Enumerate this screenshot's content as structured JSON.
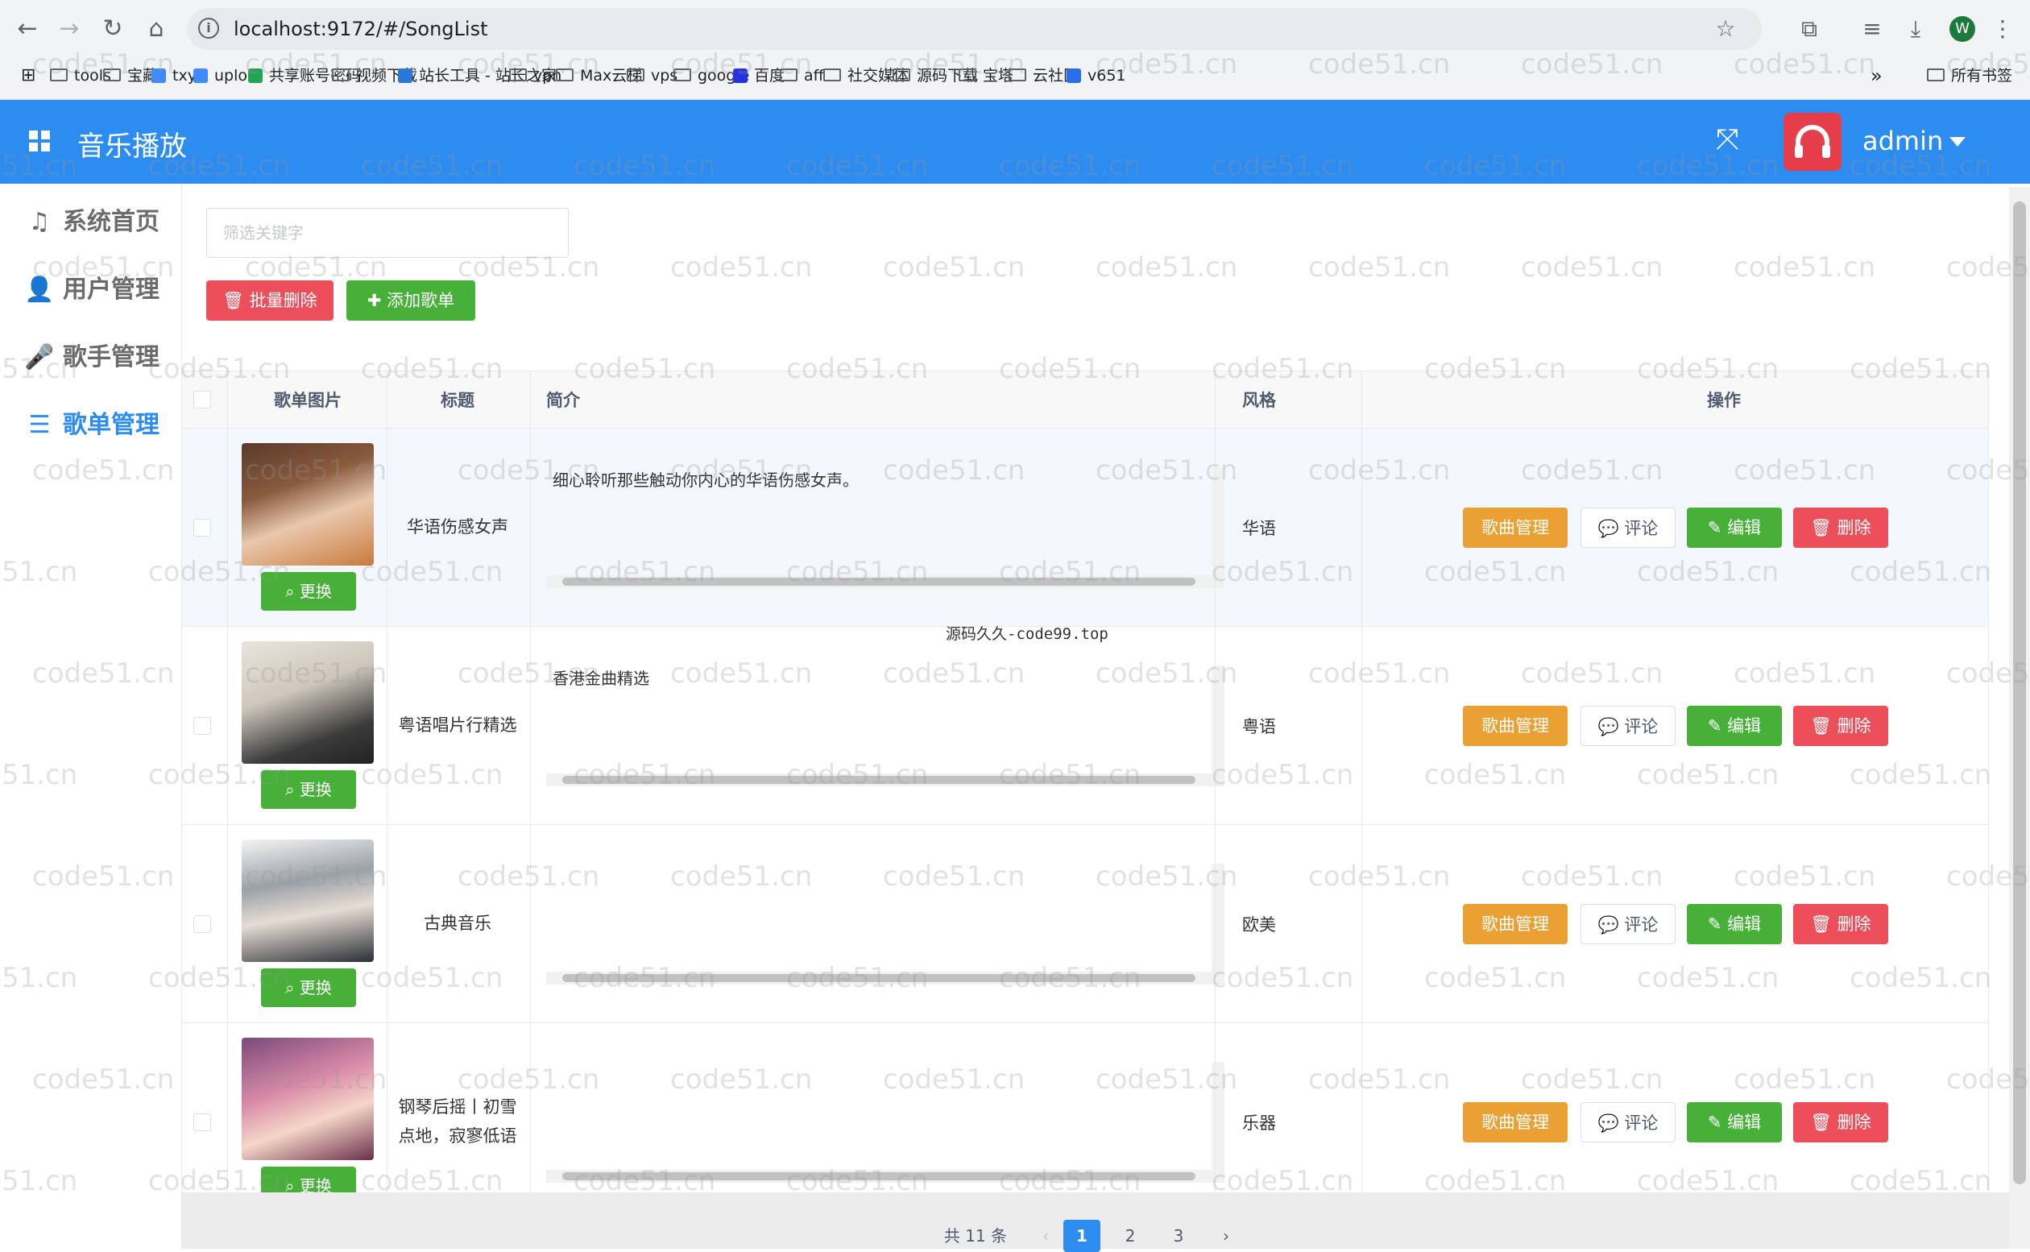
{
  "browser": {
    "url": "localhost:9172/#/SongList",
    "profile_initial": "W",
    "bookmarks": [
      {
        "label": "tools",
        "kind": "folder"
      },
      {
        "label": "宝藏",
        "kind": "folder"
      },
      {
        "label": "txy",
        "kind": "site",
        "color": "#3d8bfd"
      },
      {
        "label": "uplod",
        "kind": "site",
        "color": "#3d8bfd"
      },
      {
        "label": "共享账号密码",
        "kind": "site",
        "color": "#23a455"
      },
      {
        "label": "视频下载",
        "kind": "folder"
      },
      {
        "label": "站长工具 - 站长之家",
        "kind": "site",
        "color": "#2b77d8"
      },
      {
        "label": "vpn",
        "kind": "folder"
      },
      {
        "label": "Max云梯",
        "kind": "folder"
      },
      {
        "label": "vps",
        "kind": "folder"
      },
      {
        "label": "google",
        "kind": "folder"
      },
      {
        "label": "百度",
        "kind": "site",
        "color": "#2932e1"
      },
      {
        "label": "aff",
        "kind": "folder"
      },
      {
        "label": "社交媒体",
        "kind": "folder"
      },
      {
        "label": "源码下载",
        "kind": "folder"
      },
      {
        "label": "宝塔",
        "kind": "folder"
      },
      {
        "label": "云社区",
        "kind": "folder"
      },
      {
        "label": "v651",
        "kind": "site",
        "color": "#2a6fe8"
      }
    ],
    "all_bookmarks": "所有书签",
    "more": "»"
  },
  "app": {
    "title": "音乐播放",
    "user": "admin",
    "colors": {
      "header": "#2d8cf0",
      "logo": "#e53e4a"
    }
  },
  "sidebar": {
    "items": [
      {
        "label": "系统首页",
        "icon": "music-note-icon",
        "glyph": "♫",
        "active": false
      },
      {
        "label": "用户管理",
        "icon": "user-icon",
        "glyph": "👤",
        "active": false
      },
      {
        "label": "歌手管理",
        "icon": "microphone-icon",
        "glyph": "🎤",
        "active": false
      },
      {
        "label": "歌单管理",
        "icon": "playlist-icon",
        "glyph": "☰",
        "active": true
      }
    ]
  },
  "toolbar": {
    "search_placeholder": "筛选关键字",
    "batch_delete": "批量删除",
    "add_songlist": "添加歌单"
  },
  "table": {
    "headers": {
      "image": "歌单图片",
      "title": "标题",
      "intro": "简介",
      "style": "风格",
      "actions": "操作"
    },
    "swap_label": "更换",
    "actions": {
      "songs": "歌曲管理",
      "comment": "评论",
      "edit": "编辑",
      "delete": "删除"
    },
    "rows": [
      {
        "title": "华语伤感女声",
        "intro": "细心聆听那些触动你内心的华语伤感女声。",
        "style": "华语"
      },
      {
        "title": "粤语唱片行精选",
        "intro": "香港金曲精选",
        "style": "粤语"
      },
      {
        "title": "古典音乐",
        "intro": "",
        "style": "欧美"
      },
      {
        "title": "钢琴后摇丨初雪点地，寂寥低语",
        "intro": "",
        "style": "乐器"
      }
    ]
  },
  "pagination": {
    "total": "共 11 条",
    "pages": [
      "1",
      "2",
      "3"
    ],
    "current": "1",
    "prev": "‹",
    "next": "›"
  },
  "overlay_text": "源码久久-code99.top",
  "watermark_text": "code51.cn"
}
